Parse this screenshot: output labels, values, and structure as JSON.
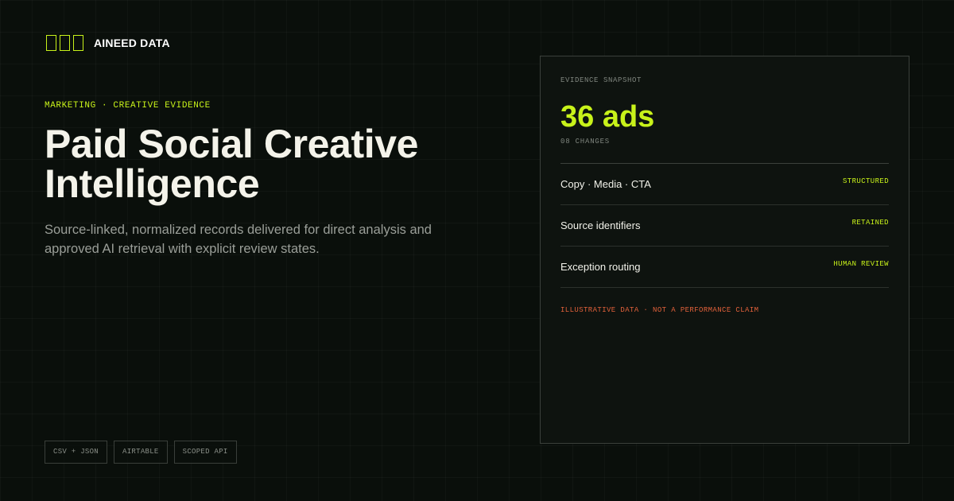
{
  "brand": {
    "name": "AINEED DATA",
    "icon": "three-square-logo",
    "accent": "#c8f21a"
  },
  "hero": {
    "eyebrow": "MARKETING · CREATIVE EVIDENCE",
    "title": "Paid Social Creative Intelligence",
    "description": "Source-linked, normalized records delivered for direct analysis and approved AI retrieval with explicit review states."
  },
  "formats": [
    "CSV + JSON",
    "AIRTABLE",
    "SCOPED API"
  ],
  "snapshot": {
    "label": "EVIDENCE SNAPSHOT",
    "metric": "36 ads",
    "metric_sub": "08 CHANGES",
    "rows": [
      {
        "label": "Copy · Media · CTA",
        "tag": "STRUCTURED"
      },
      {
        "label": "Source identifiers",
        "tag": "RETAINED"
      },
      {
        "label": "Exception routing",
        "tag": "HUMAN REVIEW"
      }
    ],
    "disclaimer": "ILLUSTRATIVE DATA · NOT A PERFORMANCE CLAIM",
    "disclaimer_color": "#e0603a"
  }
}
